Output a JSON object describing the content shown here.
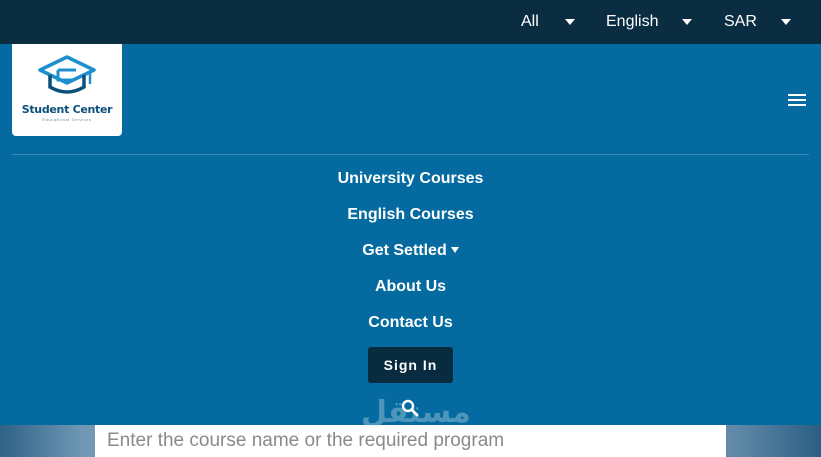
{
  "topbar": {
    "filters": [
      {
        "label": "All"
      },
      {
        "label": "English"
      },
      {
        "label": "SAR"
      }
    ]
  },
  "logo": {
    "name": "Student Center",
    "tagline": "Educational Services"
  },
  "menu": {
    "items": [
      {
        "label": "University Courses"
      },
      {
        "label": "English Courses"
      },
      {
        "label": "Get Settled"
      },
      {
        "label": "About Us"
      },
      {
        "label": "Contact Us"
      }
    ],
    "sign_in": "Sign In"
  },
  "search": {
    "placeholder": "Enter the course name or the required program"
  },
  "watermark": {
    "text": "مستقل"
  },
  "colors": {
    "topbar": "#0b2d42",
    "nav": "#046aa0",
    "button": "#082b40"
  }
}
